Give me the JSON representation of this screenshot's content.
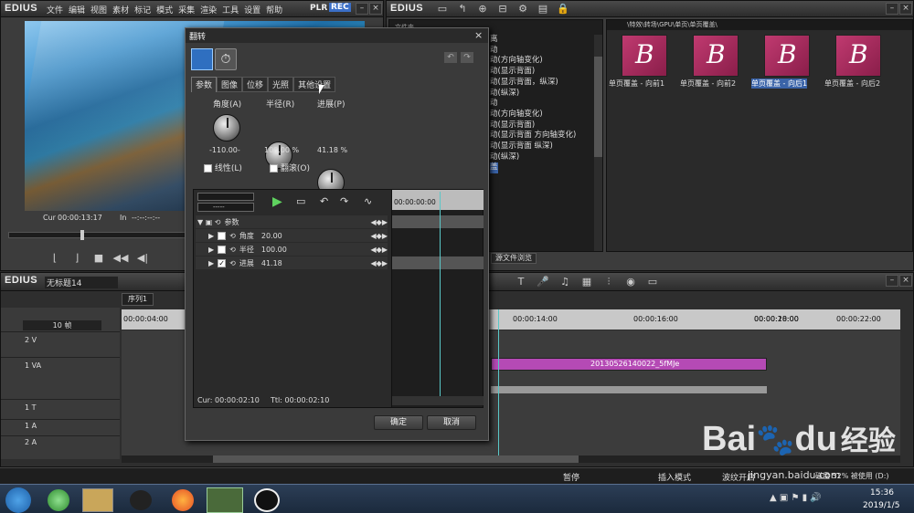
{
  "app": {
    "logo": "EDIUS"
  },
  "player": {
    "menu": [
      "文件",
      "编辑",
      "视图",
      "素材",
      "标记",
      "模式",
      "采集",
      "渲染",
      "工具",
      "设置",
      "帮助"
    ],
    "plr": "PLR",
    "rec": "REC",
    "cur_label": "Cur",
    "cur_time": "00:00:13:17",
    "in_label": "In",
    "in_time": "--:--:--:--"
  },
  "bin": {
    "logo": "EDIUS",
    "folder_label": "文件夹",
    "path": "\\特效\\转场\\GPU\\单页\\单页覆盖\\",
    "list": [
      "离",
      "动",
      "动(方向轴变化)",
      "动(显示背面)",
      "动(显示背面，纵深)",
      "动(纵深)",
      "动",
      "动(方向轴变化)",
      "动(显示背面)",
      "动(显示背面 方向轴变化)",
      "动(显示背面 纵深)",
      "动(纵深)",
      "盖"
    ],
    "tab": "源文件浏览",
    "thumbs": [
      "单页覆盖 - 向前1",
      "单页覆盖 - 向前2",
      "单页覆盖 - 向后1",
      "单页覆盖 - 向后2"
    ]
  },
  "dialog": {
    "title": "翻转",
    "tabs": [
      "参数",
      "图像",
      "位移",
      "光照",
      "其他设置"
    ],
    "knobs": [
      {
        "label": "角度(A)",
        "value": "-110.00-"
      },
      {
        "label": "半径(R)",
        "value": "100.00 %"
      },
      {
        "label": "进展(P)",
        "value": "41.18 %"
      }
    ],
    "checkbox_linear": "线性(L)",
    "checkbox_flip": "翻滚(O)",
    "speed": "-----",
    "params_header": "参数",
    "params": [
      {
        "name": "角度",
        "value": "20.00",
        "checked": false
      },
      {
        "name": "半径",
        "value": "100.00",
        "checked": false
      },
      {
        "name": "进展",
        "value": "41.18",
        "checked": true
      }
    ],
    "timecode": "00:00:00:00",
    "cur": "Cur: 00:00:02:10",
    "ttl": "Ttl: 00:00:02:10",
    "ok": "确定",
    "cancel": "取消"
  },
  "timeline": {
    "logo": "EDIUS",
    "project": "无标题14",
    "sequence_tab": "序列1",
    "scale": "10 帧",
    "ruler": [
      "00:00:04:00",
      "00:00:14:00",
      "00:00:16:00",
      "00:00:18:00",
      "00:00:20:00",
      "00:00:22:00"
    ],
    "tracks": [
      "2 V",
      "1 VA",
      "1 T",
      "1 A",
      "2 A"
    ],
    "clip_name": "20130526140022_5fMJe"
  },
  "status": {
    "pause": "暂停",
    "insert_mode": "插入模式",
    "ripple": "波纹开启",
    "disk": "磁盘 52% 被使用 (D:)"
  },
  "taskbar": {
    "time": "15:36",
    "date": "2019/1/5"
  },
  "watermark": {
    "brand": "Bai",
    "paw": "du",
    "cn": "经验",
    "url": "jingyan.baidu.com"
  }
}
